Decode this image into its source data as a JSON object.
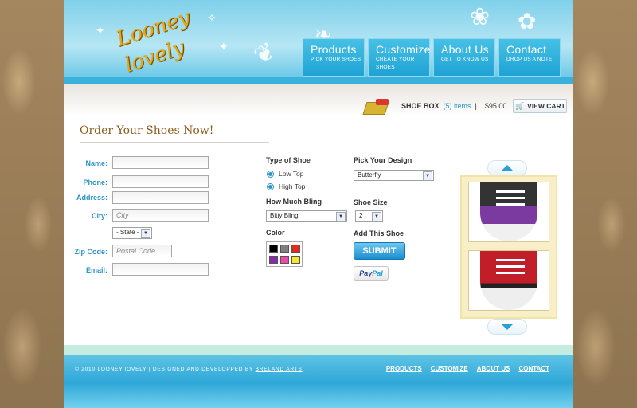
{
  "brand": {
    "logo_text": "Looney lovely"
  },
  "nav": [
    {
      "title": "Products",
      "sub": "PICK YOUR SHOES"
    },
    {
      "title": "Customize",
      "sub": "CREATE YOUR SHOES"
    },
    {
      "title": "About Us",
      "sub": "GET TO KNOW US"
    },
    {
      "title": "Contact",
      "sub": "DROP US A NOTE"
    }
  ],
  "cart": {
    "label": "SHOE BOX",
    "items": "(5) items",
    "separator": "|",
    "total": "$95.00",
    "view_cart": "VIEW CART"
  },
  "page_title": "Order Your Shoes Now!",
  "form": {
    "name_label": "Name:",
    "phone_label": "Phone:",
    "address_label": "Address:",
    "city_label": "City:",
    "city_placeholder": "City",
    "state_value": "- State -",
    "zip_label": "Zip Code:",
    "zip_placeholder": "Postal Code",
    "email_label": "Email:"
  },
  "options": {
    "type_heading": "Type of Shoe",
    "type_options": [
      "Low Top",
      "High Top"
    ],
    "bling_heading": "How Much Bling",
    "bling_value": "Bitty Bling",
    "color_heading": "Color",
    "colors": [
      "#000000",
      "#7f7f7f",
      "#e8281d",
      "#8b2aa8",
      "#f246a8",
      "#f5e82a"
    ],
    "design_heading": "Pick Your Design",
    "design_value": "Butterfly",
    "size_heading": "Shoe Size",
    "size_value": "2",
    "add_heading": "Add This Shoe",
    "submit_label": "SUBMIT",
    "paypal_pay": "Pay",
    "paypal_pal": "Pal"
  },
  "footer": {
    "copyright": "© 2010 LOONEY lOVELY  |  DESIGNED AND DEVELOPPED BY",
    "credit": "BRELAND ARTS",
    "links": [
      "PRODUCTS",
      "CUSTOMIZE",
      "ABOUT US",
      "CONTACT"
    ]
  }
}
